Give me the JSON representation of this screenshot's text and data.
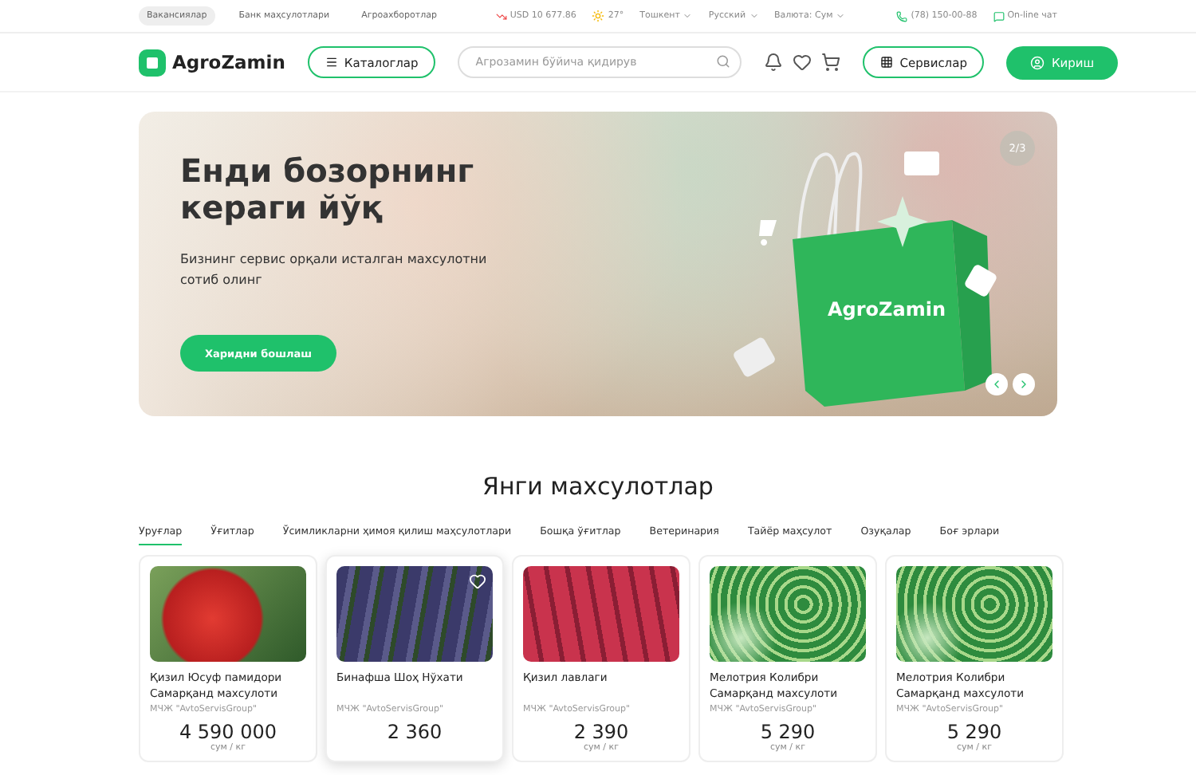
{
  "topbar": {
    "links": [
      {
        "label": "Вакансиялар",
        "selected": true
      },
      {
        "label": "Банк маҳсулотлари",
        "selected": false
      },
      {
        "label": "Агроахборотлар",
        "selected": false
      }
    ],
    "currency": "USD 10 677.86",
    "weather": "27°",
    "city": "Тошкент",
    "language": "Русский",
    "valuta": "Валюта: Сум",
    "phone": "(78) 150-00-88",
    "chat": "On-line чат"
  },
  "header": {
    "logo": "AgroZamin",
    "catalog": "Каталоглар",
    "search": {
      "placeholder": "Агрозамин бўйича қидирув"
    },
    "services": "Сервислар",
    "login": "Кириш"
  },
  "hero": {
    "title": "Енди бозорнинг кераги йўқ",
    "subtitle": "Бизнинг сервис орқали исталган махсулотни сотиб олинг",
    "button": "Харидни бошлаш",
    "bag_logo": "AgroZamin",
    "counter": "2/3"
  },
  "section_title": "Янги махсулотлар",
  "tabs": [
    {
      "label": "Уруғлар",
      "selected": true
    },
    {
      "label": "Ўғитлар",
      "selected": false
    },
    {
      "label": "Ўсимликларни ҳимоя қилиш маҳсулотлари",
      "selected": false
    },
    {
      "label": "Бошқа ўғитлар",
      "selected": false
    },
    {
      "label": "Ветеринария",
      "selected": false
    },
    {
      "label": "Тайёр маҳсулот",
      "selected": false
    },
    {
      "label": "Озуқалар",
      "selected": false
    },
    {
      "label": "Боғ эрлари",
      "selected": false
    }
  ],
  "products": [
    {
      "name": "Қизил Юсуф памидори Самарқанд махсулоти",
      "seller": "МЧЖ \"AvtoServisGroup\"",
      "price": "4 590 000",
      "unit": "сум / кг",
      "kind": "tomato",
      "hovered": false
    },
    {
      "name": "Бинафша Шоҳ Нўхати",
      "seller": "МЧЖ \"AvtoServisGroup\"",
      "price": "2 360",
      "kind": "peas",
      "hovered": true
    },
    {
      "name": "Қизил лавлаги",
      "seller": "МЧЖ \"AvtoServisGroup\"",
      "price": "2 390",
      "unit": "сум / кг",
      "kind": "beet",
      "hovered": false
    },
    {
      "name": "Мелотрия Колибри Самарқанд махсулоти",
      "seller": "МЧЖ \"AvtoServisGroup\"",
      "price": "5 290",
      "unit": "сум / кг",
      "kind": "melon",
      "hovered": false
    },
    {
      "name": "Мелотрия Колибри Самарқанд махсулоти",
      "seller": "МЧЖ \"AvtoServisGroup\"",
      "price": "5 290",
      "unit": "сум / кг",
      "kind": "melon",
      "hovered": false
    }
  ]
}
